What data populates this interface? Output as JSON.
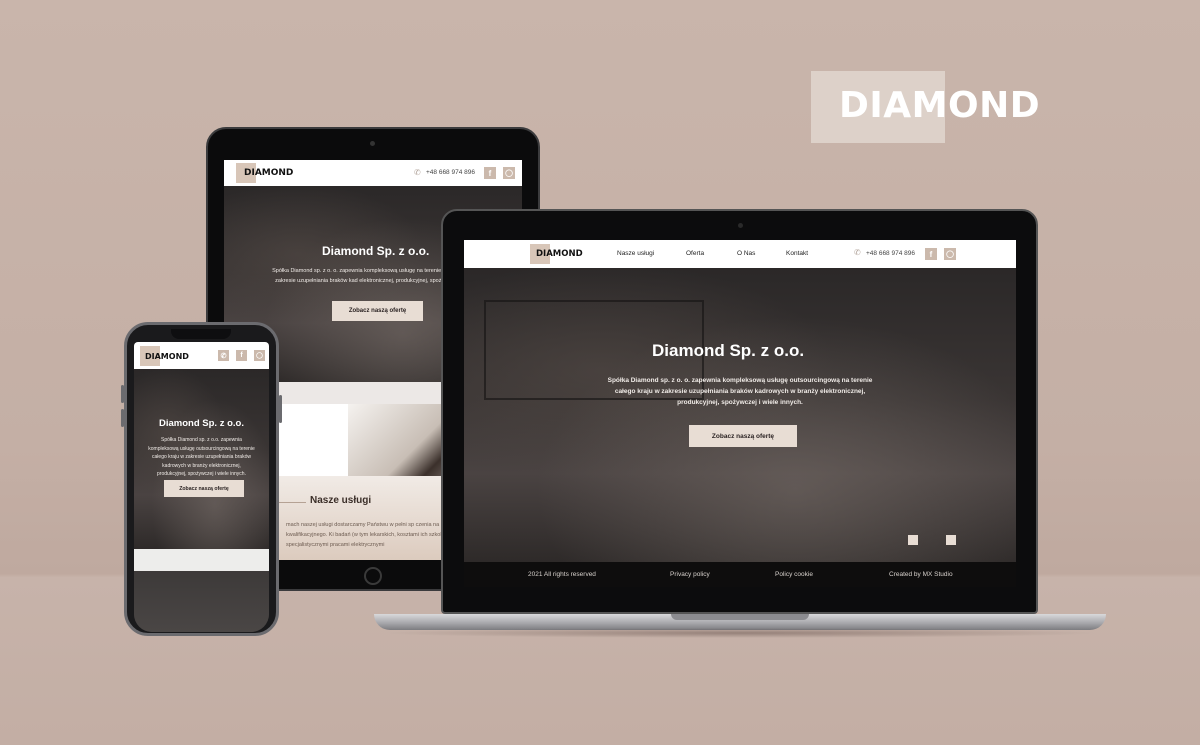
{
  "brand": {
    "logo_text": "DIAMOND",
    "accent_color": "#d8c6b8",
    "button_color": "#e8ddd4"
  },
  "header": {
    "phone": "+48 668 974 896",
    "phone_icon": "phone-icon",
    "facebook_icon": "facebook-icon",
    "instagram_icon": "instagram-icon",
    "nav": [
      "Nasze usługi",
      "Oferta",
      "O Nas",
      "Kontakt"
    ]
  },
  "hero": {
    "title": "Diamond Sp. z o.o.",
    "description": "Spółka Diamond sp. z o. o. zapewnia kompleksową usługę outsourcingową na terenie całego kraju w zakresie uzupełniania braków kadrowych w branży elektronicznej, produkcyjnej, spożywczej i wiele innych.",
    "tablet_description": "Spółka Diamond sp. z o. o. zapewnia kompleksową usługę na terenie całego kraju w zakresie uzupełniania braków kad elektronicznej, produkcyjnej, spożywczej i wiele",
    "phone_description": "Spółka Diamond sp. z o.o. zapewnia kompleksową usługę outsourcingową na terenie całego kraju w zakresie uzupełniania braków kadrowych w branży elektronicznej, produkcyjnej, spożywczej i wiele innych.",
    "cta": "Zobacz naszą ofertę"
  },
  "services": {
    "title": "Nasze usługi",
    "body": "mach naszej usługi dostarczamy Państwu w pełni sp czenia na Państwa rzecz po odbyciu kwalifikacyjnego. Ki badań (w tym lekarskich, kosztami ich szkoleń). Każdy ym objęty specjalistycznymi pracami elektrycznymi"
  },
  "footer": {
    "items": [
      "2021 All rights reserved",
      "Privacy policy",
      "Policy cookie",
      "Created by MX Studio"
    ]
  }
}
